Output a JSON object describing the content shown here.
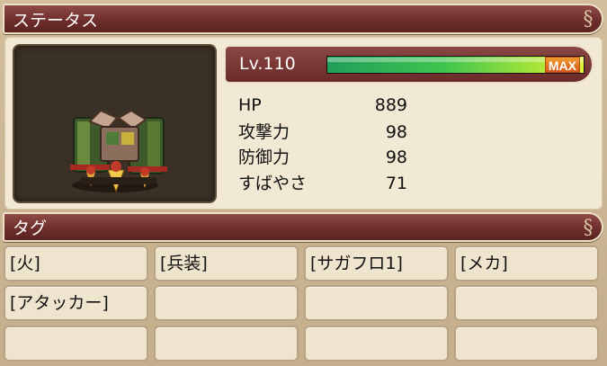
{
  "status_header": {
    "title": "ステータス"
  },
  "level": {
    "label": "Lv.110",
    "exp_fill_fraction": 1.0,
    "max_badge": "MAX"
  },
  "stats": [
    {
      "label": "HP",
      "value": "889"
    },
    {
      "label": "攻撃力",
      "value": "98"
    },
    {
      "label": "防御力",
      "value": "98"
    },
    {
      "label": "すばやさ",
      "value": "71"
    }
  ],
  "tags_header": {
    "title": "タグ"
  },
  "tags": [
    "[火]",
    "[兵装]",
    "[サガフロ1]",
    "[メカ]",
    "[アタッカー]",
    "",
    "",
    "",
    "",
    "",
    "",
    ""
  ],
  "colors": {
    "header_red": "#6e2e2b",
    "panel_cream": "#f2e9d4",
    "exp_green": "#3ec44f",
    "max_orange": "#e07a24"
  },
  "icons": {
    "header_ornament": "scroll-ornament-icon",
    "portrait": "mech-unit-portrait"
  }
}
